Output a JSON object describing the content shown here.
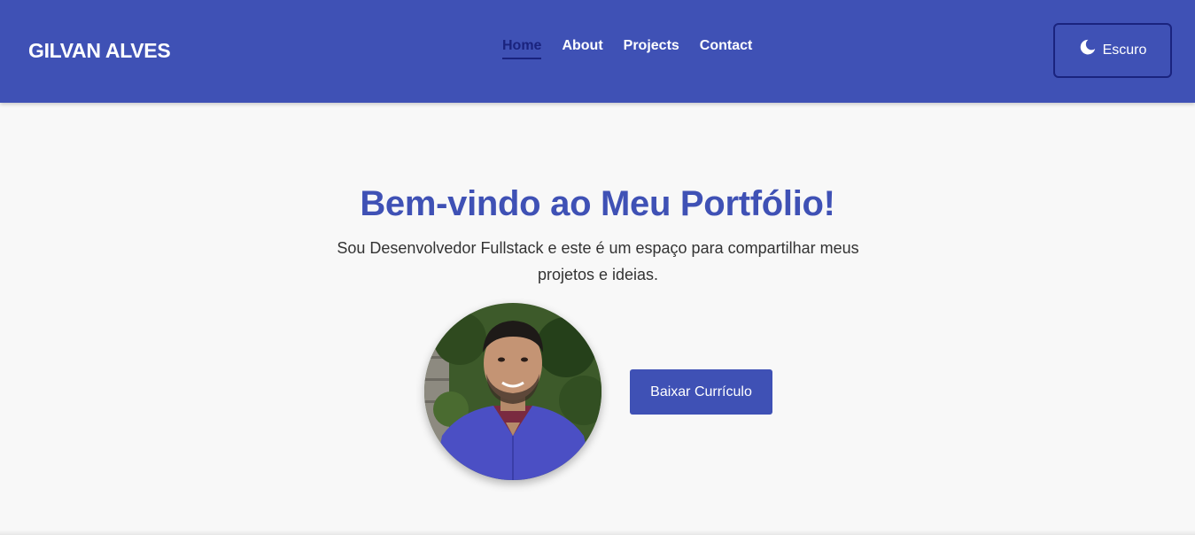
{
  "header": {
    "brand": "GILVAN ALVES",
    "nav": [
      {
        "label": "Home",
        "active": true
      },
      {
        "label": "About",
        "active": false
      },
      {
        "label": "Projects",
        "active": false
      },
      {
        "label": "Contact",
        "active": false
      }
    ],
    "theme_toggle": {
      "label": "Escuro",
      "icon": "moon-icon"
    }
  },
  "hero": {
    "title": "Bem-vindo ao Meu Portfólio!",
    "subtitle": "Sou Desenvolvedor Fullstack e este é um espaço para compartilhar meus projetos e ideias.",
    "avatar": "profile-photo",
    "cta_label": "Baixar Currículo"
  },
  "colors": {
    "primary": "#3f51b5",
    "primary_dark": "#1a237e",
    "background": "#f8f8f8",
    "text": "#333333"
  }
}
